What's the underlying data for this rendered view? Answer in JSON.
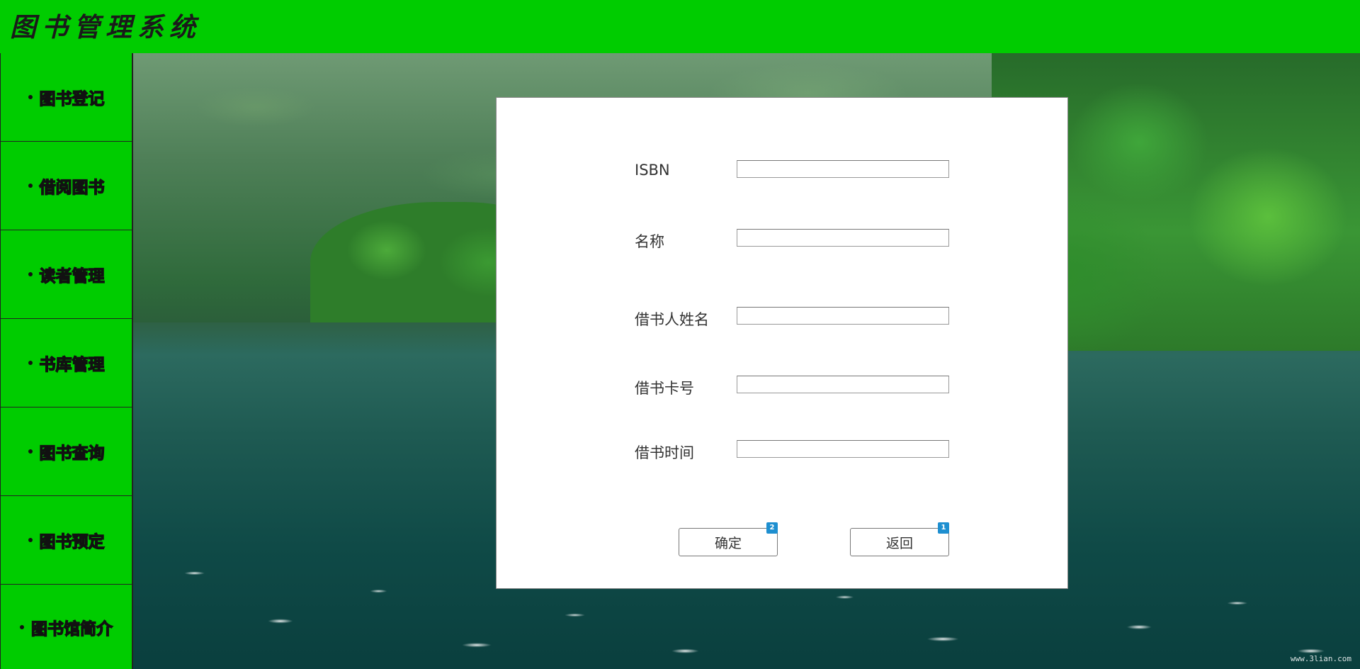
{
  "header": {
    "title": "图书管理系统"
  },
  "sidebar": {
    "items": [
      {
        "label": "图书登记"
      },
      {
        "label": "借阅图书"
      },
      {
        "label": "读者管理"
      },
      {
        "label": "书库管理"
      },
      {
        "label": "图书查询"
      },
      {
        "label": "图书预定"
      },
      {
        "label": "图书馆简介"
      }
    ]
  },
  "form": {
    "isbn_label": "ISBN",
    "isbn_value": "",
    "name_label": "名称",
    "name_value": "",
    "borrower_name_label": "借书人姓名",
    "borrower_name_value": "",
    "card_no_label": "借书卡号",
    "card_no_value": "",
    "borrow_time_label": "借书时间",
    "borrow_time_value": ""
  },
  "buttons": {
    "confirm_label": "确定",
    "confirm_badge": "2",
    "back_label": "返回",
    "back_badge": "1"
  },
  "background": {
    "watermark": "www.3lian.com"
  },
  "colors": {
    "nav_green": "#00cc00",
    "badge_blue": "#1e8fd0"
  }
}
